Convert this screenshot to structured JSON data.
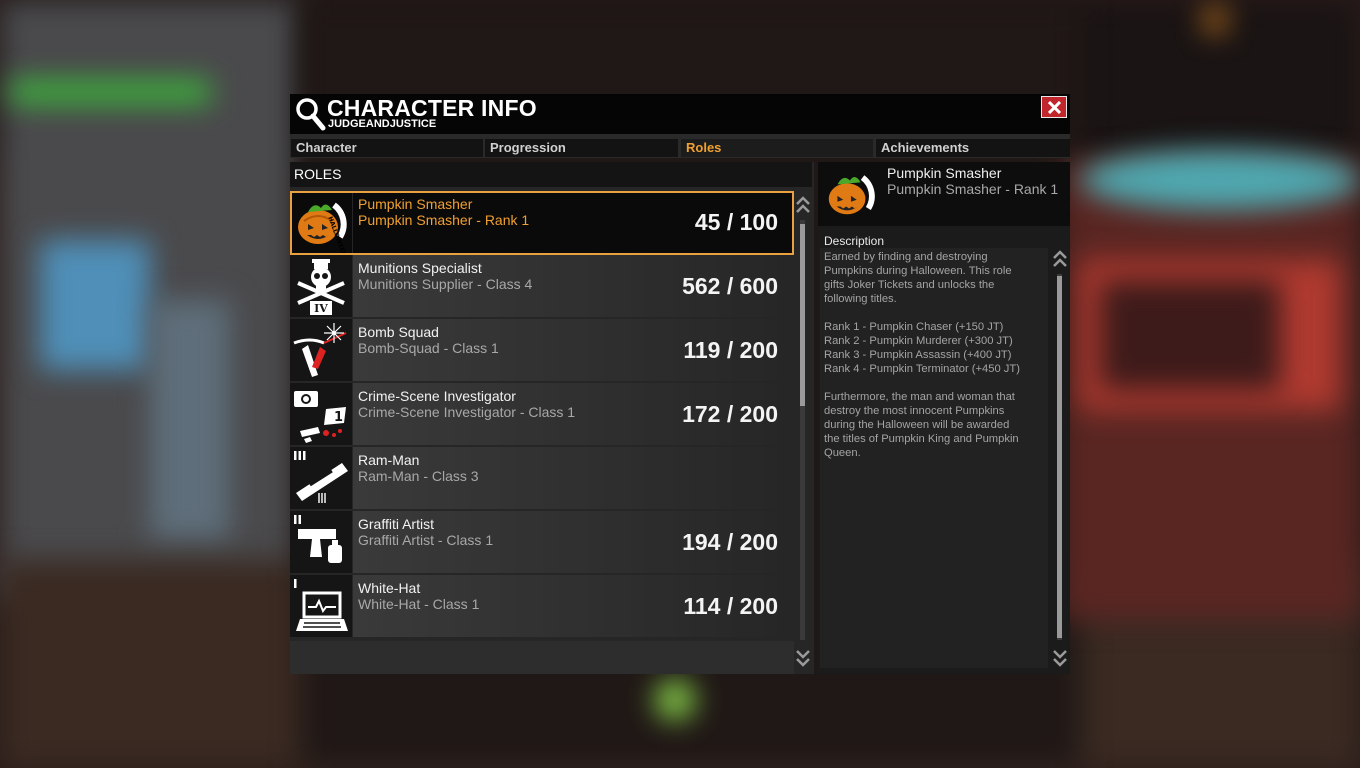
{
  "window": {
    "title": "CHARACTER INFO",
    "subtitle": "JUDGEANDJUSTICE"
  },
  "tabs": [
    {
      "label": "Character",
      "active": false
    },
    {
      "label": "Progression",
      "active": false
    },
    {
      "label": "Roles",
      "active": true
    },
    {
      "label": "Achievements",
      "active": false
    }
  ],
  "roles_header": "ROLES",
  "roles": [
    {
      "name": "Pumpkin Smasher",
      "sub": "Pumpkin Smasher - Rank 1",
      "count": "45 / 100",
      "icon": "halloween-pumpkin-icon",
      "selected": true
    },
    {
      "name": "Munitions Specialist",
      "sub": "Munitions Supplier - Class 4",
      "count": "562 / 600",
      "icon": "skull-crossed-knives-icon"
    },
    {
      "name": "Bomb Squad",
      "sub": "Bomb-Squad - Class 1",
      "count": "119 / 200",
      "icon": "wire-cutter-icon"
    },
    {
      "name": "Crime-Scene Investigator",
      "sub": "Crime-Scene Investigator - Class 1",
      "count": "172 / 200",
      "icon": "camera-evidence-icon"
    },
    {
      "name": "Ram-Man",
      "sub": "Ram-Man - Class 3",
      "count": "",
      "icon": "battering-ram-icon"
    },
    {
      "name": "Graffiti Artist",
      "sub": "Graffiti Artist - Class 1",
      "count": "194 / 200",
      "icon": "spray-can-icon"
    },
    {
      "name": "White-Hat",
      "sub": "White-Hat - Class 1",
      "count": "114 / 200",
      "icon": "laptop-icon"
    }
  ],
  "detail": {
    "name": "Pumpkin Smasher",
    "sub": "Pumpkin Smasher - Rank 1",
    "description_label": "Description",
    "description": "Earned by finding and destroying\nPumpkins during Halloween. This role\ngifts Joker Tickets and unlocks the\nfollowing titles.\n\nRank 1 - Pumpkin Chaser (+150 JT)\nRank 2 - Pumpkin Murderer (+300 JT)\nRank 3 - Pumpkin Assassin (+400 JT)\nRank 4 - Pumpkin Terminator (+450 JT)\n\nFurthermore, the man and woman that\ndestroy the most innocent Pumpkins\nduring the Halloween will be awarded\nthe titles of Pumpkin King and Pumpkin\nQueen."
  },
  "colors": {
    "accent": "#f0a030",
    "close": "#c0262c"
  }
}
